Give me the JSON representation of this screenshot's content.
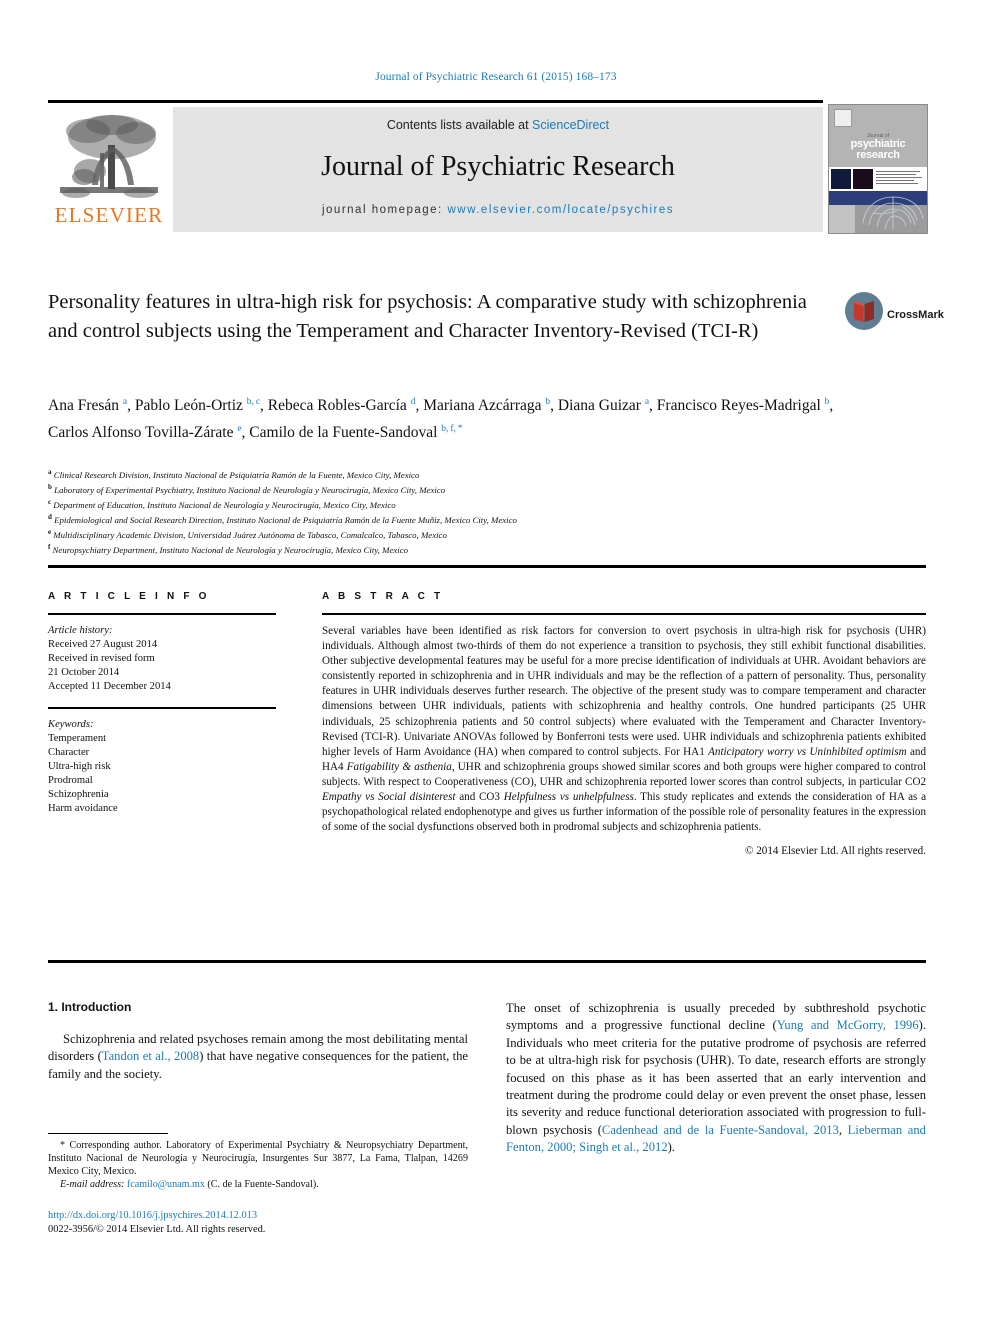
{
  "running_head": "Journal of Psychiatric Research 61 (2015) 168–173",
  "masthead": {
    "contents_prefix": "Contents lists available at ",
    "sciencedirect": "ScienceDirect",
    "journal_name": "Journal of Psychiatric Research",
    "homepage_prefix": "journal homepage: ",
    "homepage_url": "www.elsevier.com/locate/psychires",
    "publisher": "ELSEVIER",
    "cover": {
      "line1": "Journal of",
      "line2": "psychiatric",
      "line3": "research"
    }
  },
  "article": {
    "title": "Personality features in ultra-high risk for psychosis: A comparative study with schizophrenia and control subjects using the Temperament and Character Inventory-Revised (TCI-R)",
    "crossmark_label": "CrossMark",
    "authors_html": "Ana Fresán <sup>a</sup>, Pablo León-Ortiz <sup>b, c</sup>, Rebeca Robles-García <sup>d</sup>, Mariana Azcárraga <sup>b</sup>, Diana Guizar <sup>a</sup>, Francisco Reyes-Madrigal <sup>b</sup>, Carlos Alfonso Tovilla-Zárate <sup>e</sup>, Camilo de la Fuente-Sandoval <sup>b, f, *</sup>",
    "affiliations": [
      {
        "mark": "a",
        "text": "Clinical Research Division, Instituto Nacional de Psiquiatría Ramón de la Fuente, Mexico City, Mexico"
      },
      {
        "mark": "b",
        "text": "Laboratory of Experimental Psychiatry, Instituto Nacional de Neurología y Neurocirugía, Mexico City, Mexico"
      },
      {
        "mark": "c",
        "text": "Department of Education, Instituto Nacional de Neurología y Neurocirugía, Mexico City, Mexico"
      },
      {
        "mark": "d",
        "text": "Epidemiological and Social Research Direction, Instituto Nacional de Psiquiatría Ramón de la Fuente Muñiz, Mexico City, Mexico"
      },
      {
        "mark": "e",
        "text": "Multidisciplinary Academic Division, Universidad Juárez Autónoma de Tabasco, Comalcalco, Tabasco, Mexico"
      },
      {
        "mark": "f",
        "text": "Neuropsychiatry Department, Instituto Nacional de Neurología y Neurocirugía, Mexico City, Mexico"
      }
    ]
  },
  "article_info": {
    "heading": "A R T I C L E   I N F O",
    "history_label": "Article history:",
    "history_lines": [
      "Received 27 August 2014",
      "Received in revised form",
      "21 October 2014",
      "Accepted 11 December 2014"
    ],
    "keywords_label": "Keywords:",
    "keywords": [
      "Temperament",
      "Character",
      "Ultra-high risk",
      "Prodromal",
      "Schizophrenia",
      "Harm avoidance"
    ]
  },
  "abstract": {
    "heading": "A B S T R A C T",
    "body_html": "Several variables have been identified as risk factors for conversion to overt psychosis in ultra-high risk for psychosis (UHR) individuals. Although almost two-thirds of them do not experience a transition to psychosis, they still exhibit functional disabilities. Other subjective developmental features may be useful for a more precise identification of individuals at UHR. Avoidant behaviors are consistently reported in schizophrenia and in UHR individuals and may be the reflection of a pattern of personality. Thus, personality features in UHR individuals deserves further research. The objective of the present study was to compare temperament and character dimensions between UHR individuals, patients with schizophrenia and healthy controls. One hundred participants (25 UHR individuals, 25 schizophrenia patients and 50 control subjects) where evaluated with the Temperament and Character Inventory-Revised (TCI-R). Univariate ANOVAs followed by Bonferroni tests were used. UHR individuals and schizophrenia patients exhibited higher levels of Harm Avoidance (HA) when compared to control subjects. For HA1 <i>Anticipatory worry vs Uninhibited optimism</i> and HA4 <i>Fatigability &amp; asthenia</i>, UHR and schizophrenia groups showed similar scores and both groups were higher compared to control subjects. With respect to Cooperativeness (CO), UHR and schizophrenia reported lower scores than control subjects, in particular CO2 <i>Empathy vs Social disinterest</i> and CO3 <i>Helpfulness vs unhelpfulness</i>. This study replicates and extends the consideration of HA as a psychopathological related endophenotype and gives us further information of the possible role of personality features in the expression of some of the social dysfunctions observed both in prodromal subjects and schizophrenia patients.",
    "copyright": "© 2014 Elsevier Ltd. All rights reserved."
  },
  "body": {
    "section_heading": "1. Introduction",
    "left_paragraph_html": "Schizophrenia and related psychoses remain among the most debilitating mental disorders (<span class=\"lnk\">Tandon et al., 2008</span>) that have negative consequences for the patient, the family and the society.",
    "right_paragraph_html": "The onset of schizophrenia is usually preceded by subthreshold psychotic symptoms and a progressive functional decline (<span class=\"lnk\">Yung and McGorry, 1996</span>). Individuals who meet criteria for the putative prodrome of psychosis are referred to be at ultra-high risk for psychosis (UHR). To date, research efforts are strongly focused on this phase as it has been asserted that an early intervention and treatment during the prodrome could delay or even prevent the onset phase, lessen its severity and reduce functional deterioration associated with progression to full-blown psychosis (<span class=\"lnk\">Cadenhead and de la Fuente-Sandoval, 2013</span>, <span class=\"lnk\">Lieberman and Fenton, 2000; Singh et al., 2012</span>)."
  },
  "footnote": {
    "corresponding_html": "* Corresponding author. Laboratory of Experimental Psychiatry &amp; Neuropsychiatry Department, Instituto Nacional de Neurología y Neurocirugía, Insurgentes Sur 3877, La Fama, Tlalpan, 14269 Mexico City, Mexico.",
    "email_html": "<span class=\"em\">E-mail address:</span> <span class=\"lnk\">fcamilo@unam.mx</span> (C. de la Fuente-Sandoval).",
    "doi": "http://dx.doi.org/10.1016/j.jpsychires.2014.12.013",
    "issn_line": "0022-3956/© 2014 Elsevier Ltd. All rights reserved."
  },
  "colors": {
    "link_blue": "#1a7bb9",
    "elsevier_orange": "#e87722",
    "masthead_gray": "#e3e3e3"
  }
}
